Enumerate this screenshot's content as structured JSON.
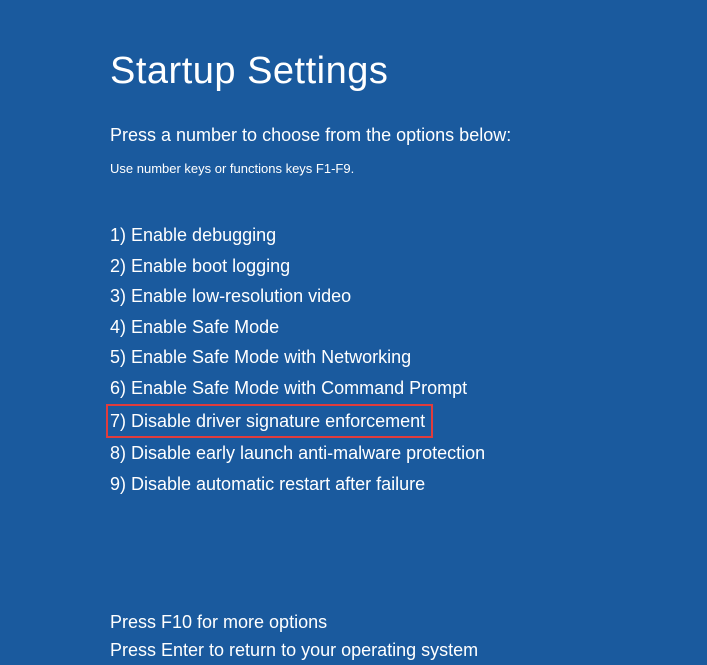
{
  "title": "Startup Settings",
  "instruction": "Press a number to choose from the options below:",
  "sub_instruction": "Use number keys or functions keys F1-F9.",
  "options": [
    "1) Enable debugging",
    "2) Enable boot logging",
    "3) Enable low-resolution video",
    "4) Enable Safe Mode",
    "5) Enable Safe Mode with Networking",
    "6) Enable Safe Mode with Command Prompt",
    "7) Disable driver signature enforcement",
    "8) Disable early launch anti-malware protection",
    "9) Disable automatic restart after failure"
  ],
  "highlighted_index": 6,
  "footer_line1": "Press F10 for more options",
  "footer_line2": "Press Enter to return to your operating system"
}
